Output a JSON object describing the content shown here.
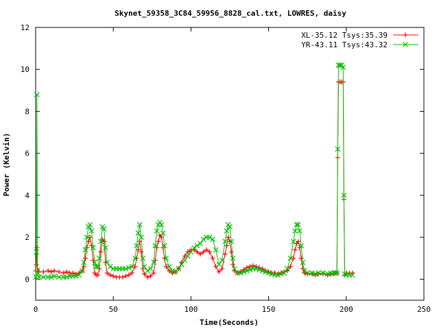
{
  "chart_data": {
    "type": "line",
    "title": "Skynet_59358_3C84_59956_8828_cal.txt, LOWRES, daisy",
    "xlabel": "Time(Seconds)",
    "ylabel": "Power (Kelvin)",
    "xlim": [
      0,
      250
    ],
    "ylim": [
      -1,
      12
    ],
    "xticks": [
      0,
      50,
      100,
      150,
      200,
      250
    ],
    "yticks": [
      0,
      2,
      4,
      6,
      8,
      10,
      12
    ],
    "grid": false,
    "legend_position": "top-right",
    "series": [
      {
        "name": "XL-35.12 Tsys:35.39",
        "color": "#ff0000",
        "marker": "plus",
        "points": [
          [
            0,
            0.4
          ],
          [
            0.5,
            0.7
          ],
          [
            0.8,
            1.5
          ],
          [
            1.2,
            0.5
          ],
          [
            2,
            0.35
          ],
          [
            5,
            0.35
          ],
          [
            8,
            0.4
          ],
          [
            10,
            0.35
          ],
          [
            12,
            0.4
          ],
          [
            15,
            0.35
          ],
          [
            18,
            0.3
          ],
          [
            20,
            0.35
          ],
          [
            22,
            0.3
          ],
          [
            24,
            0.3
          ],
          [
            26,
            0.25
          ],
          [
            28,
            0.3
          ],
          [
            30,
            0.4
          ],
          [
            31,
            0.6
          ],
          [
            32,
            1.0
          ],
          [
            33,
            1.5
          ],
          [
            34,
            1.8
          ],
          [
            35,
            2.0
          ],
          [
            36,
            1.6
          ],
          [
            37,
            0.9
          ],
          [
            38,
            0.3
          ],
          [
            39,
            0.2
          ],
          [
            40,
            0.2
          ],
          [
            41,
            0.5
          ],
          [
            42,
            1.3
          ],
          [
            43,
            1.9
          ],
          [
            44,
            1.8
          ],
          [
            45,
            0.8
          ],
          [
            46,
            0.3
          ],
          [
            48,
            0.2
          ],
          [
            50,
            0.15
          ],
          [
            52,
            0.1
          ],
          [
            54,
            0.1
          ],
          [
            56,
            0.1
          ],
          [
            58,
            0.15
          ],
          [
            60,
            0.2
          ],
          [
            62,
            0.3
          ],
          [
            64,
            0.6
          ],
          [
            65,
            1.0
          ],
          [
            66,
            1.4
          ],
          [
            67,
            1.8
          ],
          [
            68,
            1.3
          ],
          [
            69,
            0.5
          ],
          [
            70,
            0.25
          ],
          [
            72,
            0.1
          ],
          [
            74,
            0.15
          ],
          [
            76,
            0.3
          ],
          [
            77,
            0.9
          ],
          [
            78,
            1.5
          ],
          [
            79,
            1.8
          ],
          [
            80,
            2.1
          ],
          [
            81,
            2.0
          ],
          [
            82,
            1.5
          ],
          [
            83,
            1.0
          ],
          [
            84,
            0.6
          ],
          [
            86,
            0.4
          ],
          [
            88,
            0.3
          ],
          [
            90,
            0.35
          ],
          [
            92,
            0.5
          ],
          [
            94,
            0.8
          ],
          [
            96,
            1.1
          ],
          [
            98,
            1.3
          ],
          [
            100,
            1.4
          ],
          [
            102,
            1.4
          ],
          [
            104,
            1.3
          ],
          [
            106,
            1.2
          ],
          [
            108,
            1.3
          ],
          [
            110,
            1.4
          ],
          [
            112,
            1.3
          ],
          [
            114,
            1.0
          ],
          [
            116,
            0.6
          ],
          [
            118,
            0.35
          ],
          [
            120,
            0.5
          ],
          [
            122,
            1.2
          ],
          [
            123,
            1.6
          ],
          [
            124,
            2.0
          ],
          [
            125,
            1.8
          ],
          [
            126,
            1.3
          ],
          [
            127,
            0.7
          ],
          [
            128,
            0.4
          ],
          [
            130,
            0.3
          ],
          [
            132,
            0.35
          ],
          [
            134,
            0.45
          ],
          [
            136,
            0.55
          ],
          [
            138,
            0.6
          ],
          [
            140,
            0.65
          ],
          [
            142,
            0.6
          ],
          [
            144,
            0.55
          ],
          [
            146,
            0.5
          ],
          [
            148,
            0.4
          ],
          [
            150,
            0.35
          ],
          [
            152,
            0.3
          ],
          [
            154,
            0.3
          ],
          [
            156,
            0.25
          ],
          [
            158,
            0.3
          ],
          [
            160,
            0.35
          ],
          [
            162,
            0.4
          ],
          [
            164,
            0.6
          ],
          [
            166,
            1.0
          ],
          [
            167,
            1.4
          ],
          [
            168,
            1.7
          ],
          [
            169,
            1.8
          ],
          [
            170,
            1.5
          ],
          [
            171,
            1.0
          ],
          [
            172,
            0.5
          ],
          [
            173,
            0.3
          ],
          [
            175,
            0.25
          ],
          [
            178,
            0.25
          ],
          [
            180,
            0.2
          ],
          [
            182,
            0.25
          ],
          [
            185,
            0.25
          ],
          [
            188,
            0.2
          ],
          [
            190,
            0.25
          ],
          [
            192,
            0.25
          ],
          [
            193,
            0.3
          ],
          [
            194,
            0.3
          ],
          [
            194.5,
            5.8
          ],
          [
            195,
            9.4
          ],
          [
            196,
            9.4
          ],
          [
            197,
            9.4
          ],
          [
            198,
            9.4
          ],
          [
            198.5,
            3.8
          ],
          [
            199,
            0.2
          ],
          [
            200,
            0.3
          ],
          [
            202,
            0.3
          ],
          [
            204,
            0.3
          ]
        ]
      },
      {
        "name": "YR-43.11 Tsys:43.32",
        "color": "#00c000",
        "marker": "cross",
        "points": [
          [
            0,
            0.1
          ],
          [
            0.5,
            1.3
          ],
          [
            0.8,
            8.8
          ],
          [
            1.2,
            0.3
          ],
          [
            2,
            0.1
          ],
          [
            5,
            0.1
          ],
          [
            8,
            0.1
          ],
          [
            10,
            0.1
          ],
          [
            12,
            0.15
          ],
          [
            15,
            0.1
          ],
          [
            18,
            0.1
          ],
          [
            20,
            0.1
          ],
          [
            22,
            0.15
          ],
          [
            24,
            0.15
          ],
          [
            26,
            0.15
          ],
          [
            28,
            0.2
          ],
          [
            30,
            0.4
          ],
          [
            31,
            0.8
          ],
          [
            32,
            1.4
          ],
          [
            33,
            2.0
          ],
          [
            34,
            2.5
          ],
          [
            35,
            2.6
          ],
          [
            36,
            2.3
          ],
          [
            37,
            1.5
          ],
          [
            38,
            0.8
          ],
          [
            39,
            0.6
          ],
          [
            40,
            0.6
          ],
          [
            41,
            1.0
          ],
          [
            42,
            1.8
          ],
          [
            43,
            2.5
          ],
          [
            44,
            2.4
          ],
          [
            45,
            1.5
          ],
          [
            46,
            0.8
          ],
          [
            48,
            0.6
          ],
          [
            50,
            0.5
          ],
          [
            52,
            0.5
          ],
          [
            54,
            0.5
          ],
          [
            56,
            0.5
          ],
          [
            58,
            0.5
          ],
          [
            60,
            0.55
          ],
          [
            62,
            0.6
          ],
          [
            64,
            1.0
          ],
          [
            65,
            1.6
          ],
          [
            66,
            2.2
          ],
          [
            67,
            2.6
          ],
          [
            68,
            2.0
          ],
          [
            69,
            1.0
          ],
          [
            70,
            0.6
          ],
          [
            72,
            0.4
          ],
          [
            74,
            0.5
          ],
          [
            76,
            0.8
          ],
          [
            77,
            1.6
          ],
          [
            78,
            2.3
          ],
          [
            79,
            2.6
          ],
          [
            80,
            2.7
          ],
          [
            81,
            2.6
          ],
          [
            82,
            2.2
          ],
          [
            83,
            1.6
          ],
          [
            84,
            1.0
          ],
          [
            86,
            0.6
          ],
          [
            88,
            0.4
          ],
          [
            90,
            0.35
          ],
          [
            92,
            0.5
          ],
          [
            94,
            0.7
          ],
          [
            96,
            0.9
          ],
          [
            98,
            1.1
          ],
          [
            100,
            1.3
          ],
          [
            102,
            1.5
          ],
          [
            104,
            1.6
          ],
          [
            106,
            1.7
          ],
          [
            108,
            1.9
          ],
          [
            110,
            2.0
          ],
          [
            112,
            2.0
          ],
          [
            114,
            1.9
          ],
          [
            116,
            1.4
          ],
          [
            118,
            0.7
          ],
          [
            120,
            0.9
          ],
          [
            122,
            1.8
          ],
          [
            123,
            2.3
          ],
          [
            124,
            2.6
          ],
          [
            125,
            2.5
          ],
          [
            126,
            1.8
          ],
          [
            127,
            1.0
          ],
          [
            128,
            0.5
          ],
          [
            130,
            0.3
          ],
          [
            132,
            0.3
          ],
          [
            134,
            0.35
          ],
          [
            136,
            0.4
          ],
          [
            138,
            0.45
          ],
          [
            140,
            0.5
          ],
          [
            142,
            0.5
          ],
          [
            144,
            0.45
          ],
          [
            146,
            0.4
          ],
          [
            148,
            0.35
          ],
          [
            150,
            0.3
          ],
          [
            152,
            0.25
          ],
          [
            154,
            0.2
          ],
          [
            156,
            0.2
          ],
          [
            158,
            0.25
          ],
          [
            160,
            0.3
          ],
          [
            162,
            0.5
          ],
          [
            164,
            1.0
          ],
          [
            166,
            1.8
          ],
          [
            167,
            2.3
          ],
          [
            168,
            2.6
          ],
          [
            169,
            2.6
          ],
          [
            170,
            2.3
          ],
          [
            171,
            1.6
          ],
          [
            172,
            0.8
          ],
          [
            173,
            0.4
          ],
          [
            175,
            0.3
          ],
          [
            178,
            0.3
          ],
          [
            180,
            0.25
          ],
          [
            182,
            0.3
          ],
          [
            185,
            0.3
          ],
          [
            188,
            0.25
          ],
          [
            190,
            0.3
          ],
          [
            192,
            0.3
          ],
          [
            193,
            0.3
          ],
          [
            194,
            0.3
          ],
          [
            194.5,
            6.2
          ],
          [
            195,
            10.2
          ],
          [
            196,
            10.2
          ],
          [
            197,
            10.2
          ],
          [
            198,
            10.1
          ],
          [
            198.5,
            4.0
          ],
          [
            199,
            0.25
          ],
          [
            200,
            0.2
          ],
          [
            202,
            0.2
          ],
          [
            204,
            0.2
          ]
        ]
      }
    ]
  }
}
